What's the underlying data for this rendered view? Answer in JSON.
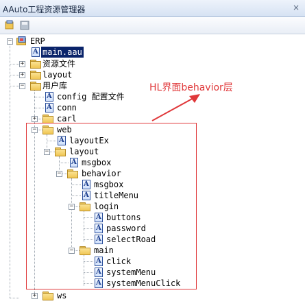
{
  "window": {
    "title": "AAuto工程资源管理器",
    "close_label": "×"
  },
  "toolbar": {
    "icons": [
      "folder-tree-icon",
      "save-icon"
    ]
  },
  "tree": {
    "root": "ERP",
    "main": "main.aau",
    "res": "资源文件",
    "layout": "layout",
    "userlib": "用户库",
    "config": "config 配置文件",
    "conn": "conn",
    "carl": "carl",
    "web": "web",
    "layoutEx": "layoutEx",
    "web_layout": "layout",
    "msgbox": "msgbox",
    "behavior": "behavior",
    "beh_msgbox": "msgbox",
    "titleMenu": "titleMenu",
    "login": "login",
    "buttons": "buttons",
    "password": "password",
    "selectRoad": "selectRoad",
    "main_folder": "main",
    "click": "click",
    "systemMenu": "systemMenu",
    "systemMenuClick": "systemMenuClick",
    "ws": "ws"
  },
  "annotation": {
    "text": "HL界面behavior层",
    "color": "#e0383a"
  }
}
